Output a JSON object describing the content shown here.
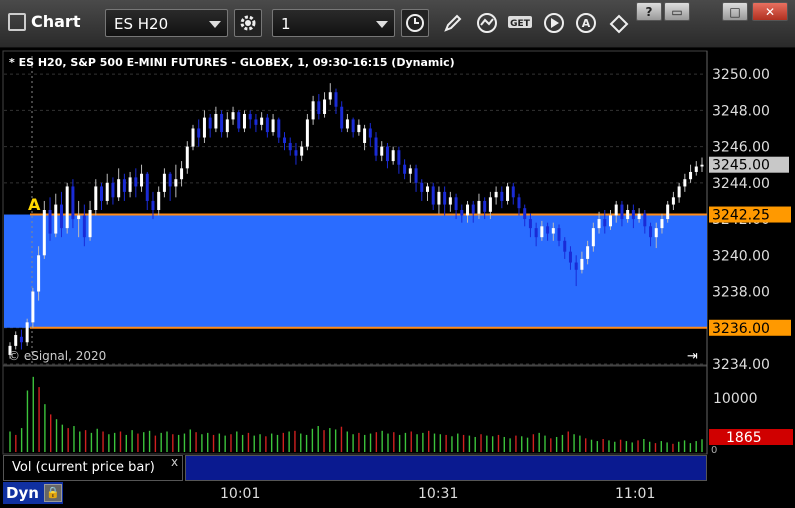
{
  "toolbar": {
    "title": "Chart",
    "symbol": "ES H20",
    "interval": "1",
    "icons": [
      "gear-icon",
      "clock-icon",
      "pencil-icon",
      "studies-icon",
      "get-icon",
      "play-icon",
      "alert-icon",
      "cursor-icon"
    ],
    "window_buttons": [
      "?",
      "▭",
      "□",
      "✕"
    ]
  },
  "chart": {
    "header": "* ES H20, S&P 500 E-MINI FUTURES - GLOBEX, 1, 09:30-16:15 (Dynamic)",
    "copyright": "© eSignal, 2020",
    "marker_label": "A",
    "price_ticks": [
      "3250.00",
      "3248.00",
      "3246.00",
      "3244.00",
      "3242.00",
      "3240.00",
      "3238.00",
      "3236.00",
      "3234.00"
    ],
    "current_price": "3245.00",
    "zone_top_label": "3242.25",
    "zone_bottom_label": "3236.00",
    "volume_tick": "10000",
    "volume_tick_zero": "0",
    "volume_current": "1865",
    "legend": "Vol (current price bar)",
    "legend_close": "x",
    "status": "Dyn",
    "time_labels": [
      "10:01",
      "10:31",
      "11:01"
    ],
    "colors": {
      "zone": "#2a6cff",
      "zone_line": "#ff8c1a",
      "up": "#ffffff",
      "down": "#1a2bd6",
      "vol_up": "#3cc43c",
      "vol_down": "#d02020",
      "price_tag": "#ff9900",
      "current_tag": "#c8c8c8",
      "vol_tag": "#d00000"
    }
  },
  "chart_data": {
    "type": "candlestick",
    "ylim": [
      3234,
      3251
    ],
    "zone": [
      3236.0,
      3242.25
    ],
    "candles": [
      [
        3234.5,
        3235.0,
        3234.3,
        3235.2
      ],
      [
        3235.0,
        3235.6,
        3234.8,
        3235.8
      ],
      [
        3235.5,
        3235.2,
        3234.8,
        3235.9
      ],
      [
        3235.2,
        3236.3,
        3235.0,
        3236.5
      ],
      [
        3236.3,
        3238.0,
        3236.0,
        3238.2
      ],
      [
        3238.0,
        3240.0,
        3237.5,
        3240.5
      ],
      [
        3240.0,
        3242.5,
        3239.8,
        3243.0
      ],
      [
        3242.5,
        3241.2,
        3240.8,
        3243.2
      ],
      [
        3241.2,
        3242.8,
        3241.0,
        3243.4
      ],
      [
        3242.8,
        3241.5,
        3241.0,
        3243.5
      ],
      [
        3241.5,
        3243.8,
        3241.2,
        3244.0
      ],
      [
        3243.8,
        3242.0,
        3241.5,
        3244.2
      ],
      [
        3242.0,
        3242.2,
        3241.0,
        3243.0
      ],
      [
        3242.2,
        3241.0,
        3240.5,
        3242.8
      ],
      [
        3241.0,
        3242.5,
        3240.8,
        3243.0
      ],
      [
        3242.5,
        3243.8,
        3242.2,
        3244.2
      ],
      [
        3243.8,
        3243.0,
        3242.5,
        3244.0
      ],
      [
        3243.0,
        3244.0,
        3242.8,
        3244.5
      ],
      [
        3244.0,
        3243.2,
        3242.8,
        3244.3
      ],
      [
        3243.2,
        3244.2,
        3243.0,
        3244.8
      ],
      [
        3244.2,
        3243.5,
        3243.0,
        3244.5
      ],
      [
        3243.5,
        3244.3,
        3243.2,
        3244.6
      ],
      [
        3244.3,
        3243.8,
        3243.2,
        3244.8
      ],
      [
        3243.8,
        3244.5,
        3243.5,
        3245.0
      ],
      [
        3244.5,
        3243.0,
        3242.5,
        3244.6
      ],
      [
        3243.0,
        3242.5,
        3242.0,
        3243.5
      ],
      [
        3242.5,
        3243.5,
        3242.2,
        3243.8
      ],
      [
        3243.5,
        3244.5,
        3243.2,
        3244.8
      ],
      [
        3244.5,
        3243.8,
        3243.0,
        3244.6
      ],
      [
        3243.8,
        3244.2,
        3243.2,
        3245.0
      ],
      [
        3244.2,
        3244.8,
        3243.8,
        3245.2
      ],
      [
        3244.8,
        3246.0,
        3244.5,
        3246.3
      ],
      [
        3246.0,
        3247.0,
        3245.8,
        3247.2
      ],
      [
        3247.0,
        3246.5,
        3246.0,
        3247.5
      ],
      [
        3246.5,
        3247.6,
        3246.2,
        3248.0
      ],
      [
        3247.6,
        3247.0,
        3246.5,
        3247.8
      ],
      [
        3247.0,
        3247.8,
        3246.8,
        3248.2
      ],
      [
        3247.8,
        3246.8,
        3246.5,
        3248.0
      ],
      [
        3246.8,
        3247.5,
        3246.5,
        3247.9
      ],
      [
        3247.5,
        3247.9,
        3247.2,
        3248.2
      ],
      [
        3247.9,
        3247.0,
        3246.8,
        3248.0
      ],
      [
        3247.0,
        3247.8,
        3246.8,
        3248.0
      ],
      [
        3247.8,
        3247.5,
        3247.0,
        3248.0
      ],
      [
        3247.5,
        3247.2,
        3246.8,
        3247.8
      ],
      [
        3247.2,
        3247.6,
        3246.9,
        3247.9
      ],
      [
        3247.6,
        3246.8,
        3246.5,
        3247.8
      ],
      [
        3246.8,
        3247.5,
        3246.6,
        3247.8
      ],
      [
        3247.5,
        3246.5,
        3246.2,
        3247.6
      ],
      [
        3246.5,
        3246.2,
        3245.8,
        3246.8
      ],
      [
        3246.2,
        3245.8,
        3245.5,
        3246.5
      ],
      [
        3245.8,
        3245.5,
        3245.0,
        3246.2
      ],
      [
        3245.5,
        3246.0,
        3245.2,
        3246.3
      ],
      [
        3246.0,
        3247.5,
        3245.8,
        3247.8
      ],
      [
        3247.5,
        3248.5,
        3247.2,
        3248.8
      ],
      [
        3248.5,
        3247.8,
        3247.5,
        3248.9
      ],
      [
        3247.8,
        3248.6,
        3247.6,
        3249.0
      ],
      [
        3248.6,
        3249.0,
        3248.3,
        3249.5
      ],
      [
        3249.0,
        3248.2,
        3247.8,
        3249.2
      ],
      [
        3248.2,
        3247.0,
        3246.8,
        3248.5
      ],
      [
        3247.0,
        3247.5,
        3246.8,
        3247.8
      ],
      [
        3247.5,
        3246.8,
        3246.5,
        3247.6
      ],
      [
        3246.8,
        3247.2,
        3246.6,
        3247.5
      ],
      [
        3246.2,
        3247.0,
        3245.8,
        3247.2
      ],
      [
        3247.0,
        3246.5,
        3246.0,
        3247.3
      ],
      [
        3246.5,
        3245.5,
        3245.2,
        3246.8
      ],
      [
        3245.5,
        3246.0,
        3245.2,
        3246.3
      ],
      [
        3246.0,
        3245.2,
        3244.8,
        3246.2
      ],
      [
        3245.2,
        3245.8,
        3245.0,
        3246.0
      ],
      [
        3245.8,
        3245.0,
        3244.5,
        3246.0
      ],
      [
        3245.0,
        3244.5,
        3244.2,
        3245.3
      ],
      [
        3244.5,
        3244.8,
        3244.0,
        3245.0
      ],
      [
        3244.8,
        3244.0,
        3243.5,
        3245.0
      ],
      [
        3244.0,
        3243.5,
        3243.0,
        3244.2
      ],
      [
        3243.5,
        3243.8,
        3243.0,
        3244.0
      ],
      [
        3243.8,
        3242.8,
        3242.5,
        3244.0
      ],
      [
        3242.8,
        3243.5,
        3242.3,
        3243.8
      ],
      [
        3243.5,
        3242.8,
        3242.2,
        3243.8
      ],
      [
        3242.8,
        3243.2,
        3242.4,
        3243.5
      ],
      [
        3243.2,
        3242.5,
        3242.0,
        3243.4
      ],
      [
        3242.5,
        3242.2,
        3241.8,
        3242.8
      ],
      [
        3242.2,
        3242.8,
        3241.8,
        3243.0
      ],
      [
        3242.8,
        3242.3,
        3241.8,
        3243.0
      ],
      [
        3242.3,
        3243.0,
        3242.0,
        3243.4
      ],
      [
        3243.0,
        3242.4,
        3242.0,
        3243.2
      ],
      [
        3242.4,
        3243.2,
        3242.0,
        3243.5
      ],
      [
        3243.2,
        3243.5,
        3242.8,
        3243.8
      ],
      [
        3243.5,
        3243.0,
        3242.6,
        3243.8
      ],
      [
        3243.0,
        3243.8,
        3242.8,
        3244.0
      ],
      [
        3243.8,
        3243.2,
        3242.8,
        3244.0
      ],
      [
        3243.2,
        3242.6,
        3242.2,
        3243.4
      ],
      [
        3242.6,
        3242.0,
        3241.6,
        3242.8
      ],
      [
        3242.0,
        3241.5,
        3241.0,
        3242.3
      ],
      [
        3241.5,
        3241.0,
        3240.5,
        3241.8
      ],
      [
        3241.0,
        3241.6,
        3240.8,
        3241.9
      ],
      [
        3241.6,
        3241.2,
        3240.8,
        3241.8
      ],
      [
        3241.2,
        3241.5,
        3240.8,
        3241.8
      ],
      [
        3241.5,
        3240.8,
        3240.5,
        3241.7
      ],
      [
        3240.8,
        3240.2,
        3239.8,
        3241.0
      ],
      [
        3240.2,
        3239.6,
        3239.2,
        3240.5
      ],
      [
        3239.6,
        3239.2,
        3238.3,
        3240.0
      ],
      [
        3239.2,
        3239.8,
        3239.0,
        3240.2
      ],
      [
        3239.8,
        3240.5,
        3239.5,
        3240.8
      ],
      [
        3240.5,
        3241.5,
        3240.2,
        3241.8
      ],
      [
        3241.5,
        3242.0,
        3241.2,
        3242.4
      ],
      [
        3242.0,
        3241.6,
        3241.2,
        3242.5
      ],
      [
        3241.6,
        3242.2,
        3241.4,
        3242.5
      ],
      [
        3242.2,
        3242.8,
        3241.8,
        3243.0
      ],
      [
        3242.8,
        3242.0,
        3241.6,
        3243.0
      ],
      [
        3242.0,
        3242.5,
        3241.8,
        3242.8
      ],
      [
        3242.5,
        3242.0,
        3241.5,
        3242.8
      ],
      [
        3242.0,
        3242.3,
        3241.8,
        3242.6
      ],
      [
        3242.3,
        3241.6,
        3241.2,
        3242.5
      ],
      [
        3241.6,
        3241.0,
        3240.5,
        3241.8
      ],
      [
        3241.0,
        3241.5,
        3240.4,
        3241.8
      ],
      [
        3241.5,
        3242.0,
        3241.2,
        3242.3
      ],
      [
        3242.0,
        3242.8,
        3241.8,
        3243.0
      ],
      [
        3242.8,
        3243.2,
        3242.5,
        3243.5
      ],
      [
        3243.2,
        3243.8,
        3242.9,
        3244.0
      ],
      [
        3243.8,
        3244.2,
        3243.5,
        3244.5
      ],
      [
        3244.2,
        3244.6,
        3244.0,
        3245.0
      ],
      [
        3244.6,
        3244.9,
        3244.4,
        3245.2
      ],
      [
        3244.9,
        3245.0,
        3244.6,
        3245.4
      ]
    ],
    "volumes": [
      [
        3000,
        1
      ],
      [
        2500,
        0
      ],
      [
        3500,
        1
      ],
      [
        9000,
        1
      ],
      [
        11000,
        1
      ],
      [
        9500,
        0
      ],
      [
        7000,
        1
      ],
      [
        5500,
        0
      ],
      [
        4800,
        1
      ],
      [
        4000,
        1
      ],
      [
        3500,
        0
      ],
      [
        3800,
        1
      ],
      [
        3000,
        1
      ],
      [
        3200,
        0
      ],
      [
        2800,
        1
      ],
      [
        3400,
        1
      ],
      [
        3000,
        0
      ],
      [
        2600,
        1
      ],
      [
        2800,
        1
      ],
      [
        3000,
        0
      ],
      [
        2500,
        1
      ],
      [
        3200,
        1
      ],
      [
        2700,
        0
      ],
      [
        2900,
        1
      ],
      [
        3100,
        1
      ],
      [
        2400,
        0
      ],
      [
        2800,
        1
      ],
      [
        3000,
        1
      ],
      [
        2600,
        0
      ],
      [
        2500,
        1
      ],
      [
        2700,
        1
      ],
      [
        3300,
        1
      ],
      [
        2900,
        0
      ],
      [
        2600,
        1
      ],
      [
        2800,
        1
      ],
      [
        2500,
        0
      ],
      [
        2700,
        1
      ],
      [
        2400,
        1
      ],
      [
        2600,
        0
      ],
      [
        3000,
        1
      ],
      [
        2500,
        1
      ],
      [
        2800,
        0
      ],
      [
        2400,
        1
      ],
      [
        2600,
        1
      ],
      [
        2300,
        0
      ],
      [
        2700,
        1
      ],
      [
        2500,
        1
      ],
      [
        2800,
        0
      ],
      [
        3000,
        1
      ],
      [
        3100,
        0
      ],
      [
        2700,
        1
      ],
      [
        2500,
        1
      ],
      [
        3400,
        1
      ],
      [
        3800,
        1
      ],
      [
        3200,
        0
      ],
      [
        3500,
        1
      ],
      [
        3300,
        1
      ],
      [
        3700,
        0
      ],
      [
        3000,
        1
      ],
      [
        2600,
        1
      ],
      [
        2800,
        0
      ],
      [
        2500,
        1
      ],
      [
        2700,
        1
      ],
      [
        2900,
        0
      ],
      [
        3100,
        1
      ],
      [
        2700,
        1
      ],
      [
        2900,
        0
      ],
      [
        2500,
        1
      ],
      [
        2800,
        1
      ],
      [
        3000,
        0
      ],
      [
        2600,
        1
      ],
      [
        2800,
        1
      ],
      [
        3100,
        0
      ],
      [
        2700,
        1
      ],
      [
        2600,
        1
      ],
      [
        2500,
        0
      ],
      [
        2300,
        1
      ],
      [
        2700,
        1
      ],
      [
        2500,
        0
      ],
      [
        2400,
        1
      ],
      [
        2200,
        1
      ],
      [
        2600,
        0
      ],
      [
        2400,
        1
      ],
      [
        2300,
        1
      ],
      [
        2500,
        0
      ],
      [
        2200,
        1
      ],
      [
        2000,
        1
      ],
      [
        2400,
        0
      ],
      [
        2300,
        1
      ],
      [
        2100,
        1
      ],
      [
        2600,
        0
      ],
      [
        2800,
        1
      ],
      [
        2400,
        1
      ],
      [
        2000,
        0
      ],
      [
        2200,
        1
      ],
      [
        2500,
        1
      ],
      [
        3000,
        0
      ],
      [
        2600,
        1
      ],
      [
        2400,
        1
      ],
      [
        2000,
        0
      ],
      [
        1800,
        1
      ],
      [
        1600,
        1
      ],
      [
        1900,
        0
      ],
      [
        1700,
        1
      ],
      [
        1500,
        1
      ],
      [
        1800,
        0
      ],
      [
        1600,
        1
      ],
      [
        1400,
        1
      ],
      [
        1700,
        0
      ],
      [
        1900,
        1
      ],
      [
        1500,
        1
      ],
      [
        1300,
        0
      ],
      [
        1600,
        1
      ],
      [
        1400,
        1
      ],
      [
        1200,
        0
      ],
      [
        1500,
        1
      ],
      [
        1700,
        1
      ],
      [
        1300,
        1
      ],
      [
        1600,
        1
      ],
      [
        1865,
        1
      ]
    ]
  }
}
